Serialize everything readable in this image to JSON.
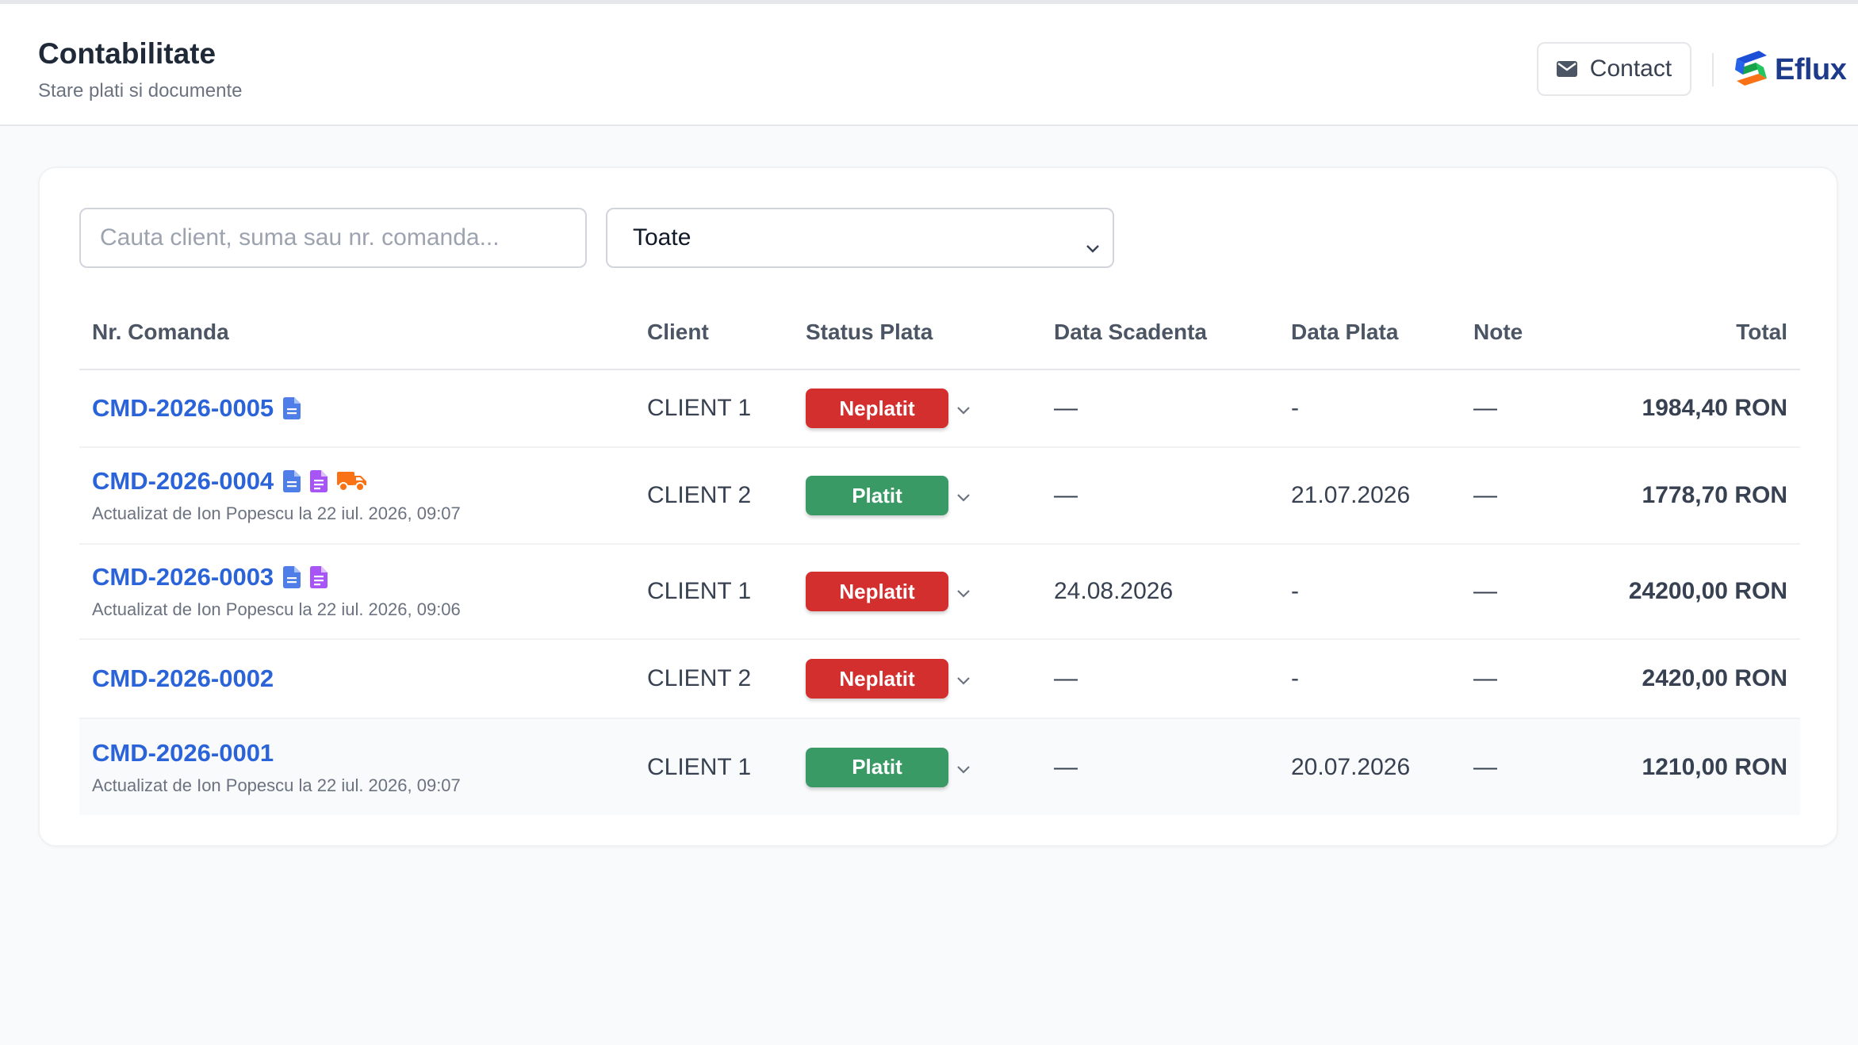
{
  "header": {
    "title": "Contabilitate",
    "subtitle": "Stare plati si documente",
    "contact_label": "Contact",
    "logo_text": "Eflux"
  },
  "filters": {
    "search_placeholder": "Cauta client, suma sau nr. comanda...",
    "status_selected": "Toate"
  },
  "table": {
    "columns": [
      "Nr. Comanda",
      "Client",
      "Status Plata",
      "Data Scadenta",
      "Data Plata",
      "Note",
      "Total"
    ],
    "rows": [
      {
        "order": "CMD-2026-0005",
        "updated": "",
        "client": "CLIENT 1",
        "status": "Neplatit",
        "due_date": "—",
        "paid_date": "-",
        "note": "—",
        "total": "1984,40 RON",
        "icons": [
          "invoice-icon"
        ]
      },
      {
        "order": "CMD-2026-0004",
        "updated": "Actualizat de Ion Popescu la 22 iul. 2026, 09:07",
        "client": "CLIENT 2",
        "status": "Platit",
        "due_date": "—",
        "paid_date": "21.07.2026",
        "note": "—",
        "total": "1778,70 RON",
        "icons": [
          "invoice-icon",
          "receipt-icon",
          "delivery-truck-icon"
        ]
      },
      {
        "order": "CMD-2026-0003",
        "updated": "Actualizat de Ion Popescu la 22 iul. 2026, 09:06",
        "client": "CLIENT 1",
        "status": "Neplatit",
        "due_date": "24.08.2026",
        "paid_date": "-",
        "note": "—",
        "total": "24200,00 RON",
        "icons": [
          "invoice-icon",
          "receipt-icon"
        ]
      },
      {
        "order": "CMD-2026-0002",
        "updated": "",
        "client": "CLIENT 2",
        "status": "Neplatit",
        "due_date": "—",
        "paid_date": "-",
        "note": "—",
        "total": "2420,00 RON",
        "icons": []
      },
      {
        "order": "CMD-2026-0001",
        "updated": "Actualizat de Ion Popescu la 22 iul. 2026, 09:07",
        "client": "CLIENT 1",
        "status": "Platit",
        "due_date": "—",
        "paid_date": "20.07.2026",
        "note": "—",
        "total": "1210,00 RON",
        "icons": []
      }
    ]
  },
  "colors": {
    "unpaid": "#d32f2f",
    "paid": "#3a9a66",
    "link": "#2b63d9",
    "invoice_icon": "#4f7ee8",
    "receipt_icon": "#a855f7",
    "truck_icon": "#f97316",
    "logo_text": "#1e3a8a"
  }
}
